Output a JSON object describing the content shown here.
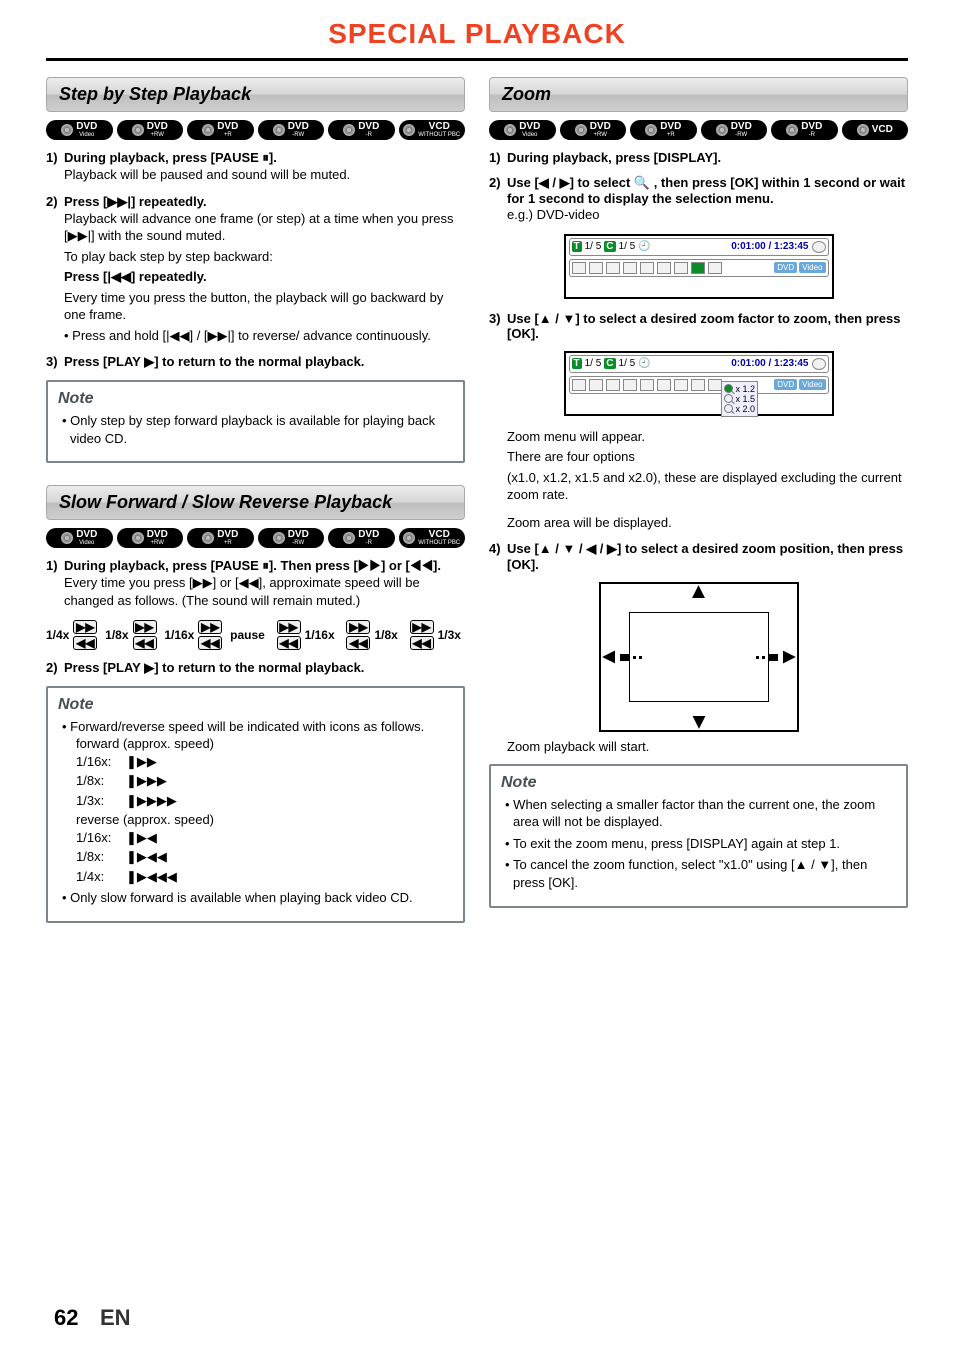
{
  "page": {
    "title": "SPECIAL PLAYBACK",
    "number": "62",
    "lang": "EN"
  },
  "discs": {
    "left": [
      {
        "main": "DVD",
        "sub": "Video"
      },
      {
        "main": "DVD",
        "sub": "+RW"
      },
      {
        "main": "DVD",
        "sub": "+R"
      },
      {
        "main": "DVD",
        "sub": "-RW"
      },
      {
        "main": "DVD",
        "sub": "-R"
      },
      {
        "main": "VCD",
        "sub": "WITHOUT PBC"
      }
    ],
    "zoom": [
      {
        "main": "DVD",
        "sub": "Video"
      },
      {
        "main": "DVD",
        "sub": "+RW"
      },
      {
        "main": "DVD",
        "sub": "+R"
      },
      {
        "main": "DVD",
        "sub": "-RW"
      },
      {
        "main": "DVD",
        "sub": "-R"
      },
      {
        "main": "VCD",
        "sub": ""
      }
    ],
    "slow": [
      {
        "main": "DVD",
        "sub": "Video"
      },
      {
        "main": "DVD",
        "sub": "+RW"
      },
      {
        "main": "DVD",
        "sub": "+R"
      },
      {
        "main": "DVD",
        "sub": "-RW"
      },
      {
        "main": "DVD",
        "sub": "-R"
      },
      {
        "main": "VCD",
        "sub": "WITHOUT PBC"
      }
    ]
  },
  "stepbystep": {
    "title": "Step by Step Playback",
    "s1_head": "During playback, press [PAUSE ⏸].",
    "s1_body": "Playback will be paused and sound will be muted.",
    "s2_head": "Press [▶▶|] repeatedly.",
    "s2_body1": "Playback will advance one frame (or step) at a time when you press [▶▶|] with the sound muted.",
    "s2_body2": "To play back step by step backward:",
    "s2_body3": "Press [|◀◀] repeatedly.",
    "s2_body4": "Every time you press the button, the playback will go backward by one frame.",
    "s2_body5": "• Press and hold [|◀◀] / [▶▶|] to reverse/ advance continuously.",
    "s3_head": "Press [PLAY ▶] to return to the normal playback.",
    "note_title": "Note",
    "note1": "Only step by step forward playback is available for playing back video CD."
  },
  "slow": {
    "title": "Slow Forward / Slow Reverse Playback",
    "s1_head": "During playback, press [PAUSE ⏸]. Then press [▶▶] or [◀◀].",
    "s1_body": "Every time you press [▶▶] or [◀◀], approximate speed will be changed as follows. (The sound will remain muted.)",
    "diagram_labels": [
      "1/4x",
      "1/8x",
      "1/16x",
      "pause",
      "1/16x",
      "1/8x",
      "1/3x"
    ],
    "s2_head": "Press [PLAY ▶] to return to the normal playback.",
    "note_title": "Note",
    "note_lead": "Forward/reverse speed will be indicated with icons as follows.",
    "fwd_label": "forward (approx. speed)",
    "fwd": [
      {
        "label": "1/16x:",
        "glyph": "❚▶▶"
      },
      {
        "label": "1/8x:",
        "glyph": "❚▶▶▶"
      },
      {
        "label": "1/3x:",
        "glyph": "❚▶▶▶▶"
      }
    ],
    "rev_label": "reverse (approx. speed)",
    "rev": [
      {
        "label": "1/16x:",
        "glyph": "❚▶◀"
      },
      {
        "label": "1/8x:",
        "glyph": "❚▶◀◀"
      },
      {
        "label": "1/4x:",
        "glyph": "❚▶◀◀◀"
      }
    ],
    "note2": "Only slow forward is available when playing back video CD."
  },
  "zoom": {
    "title": "Zoom",
    "s1_head": "During playback, press [DISPLAY].",
    "s2_head": "Use [◀ / ▶] to select 🔍 , then press [OK] within 1 second or wait for 1 second to display the selection menu.",
    "s2_eg": "e.g.) DVD-video",
    "osd": {
      "row1": {
        "t": "T",
        "val1": "1/  5",
        "c": "C",
        "val2": "1/  5",
        "clock": "🕘",
        "time": "0:01:00 / 1:23:45"
      },
      "row2_pills": [
        "DVD",
        "Video"
      ],
      "zoom_opts": [
        "x 1.2",
        "x 1.5",
        "x 2.0"
      ]
    },
    "s3_head": "Use [▲ / ▼] to select a desired zoom factor to zoom, then press [OK].",
    "s3_body1": "Zoom menu will appear.",
    "s3_body2": "There are four options",
    "s3_body3": "(x1.0, x1.2, x1.5 and x2.0), these are displayed excluding the current zoom rate.",
    "s3_body4": "Zoom area will be displayed.",
    "s4_head": "Use [▲ / ▼ / ◀ / ▶] to select a desired zoom position, then press [OK].",
    "s4_body": "Zoom playback will start.",
    "note_title": "Note",
    "note1": "When selecting a smaller factor than the current one, the zoom area will not be displayed.",
    "note2": "To exit the zoom menu, press [DISPLAY] again at step 1.",
    "note3": "To cancel the zoom function, select \"x1.0\" using [▲ / ▼], then press [OK]."
  }
}
